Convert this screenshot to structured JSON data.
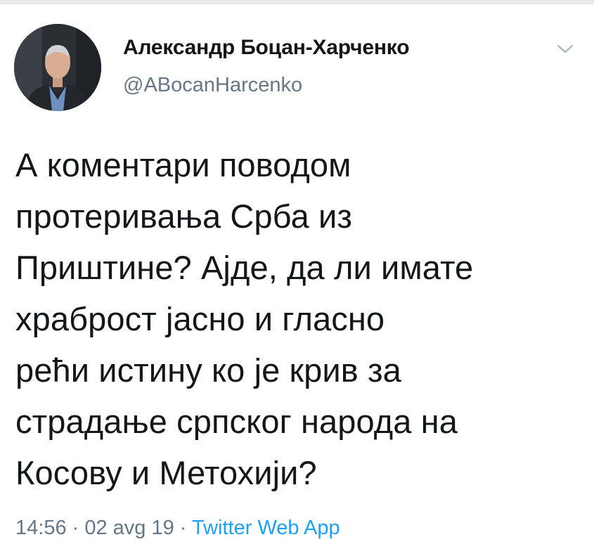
{
  "author": {
    "display_name": "Александр Боцан-Харченко",
    "handle": "@ABocanHarcenko",
    "avatar_icon": "profile-photo",
    "menu_icon": "chevron-down-icon"
  },
  "tweet": {
    "lines": [
      "А коментари поводом",
      "протеривања Срба из",
      "Приштине? Ајде, да ли имате",
      "храброст јасно и гласно",
      "рећи истину ко је крив за",
      "страдање српског народа на",
      "Косову и Метохији?"
    ]
  },
  "meta": {
    "time": "14:56",
    "separator": " · ",
    "date": "02 avg 19",
    "source": "Twitter Web App"
  },
  "colors": {
    "text": "#14171a",
    "secondary": "#657786",
    "link": "#1da1f2"
  }
}
